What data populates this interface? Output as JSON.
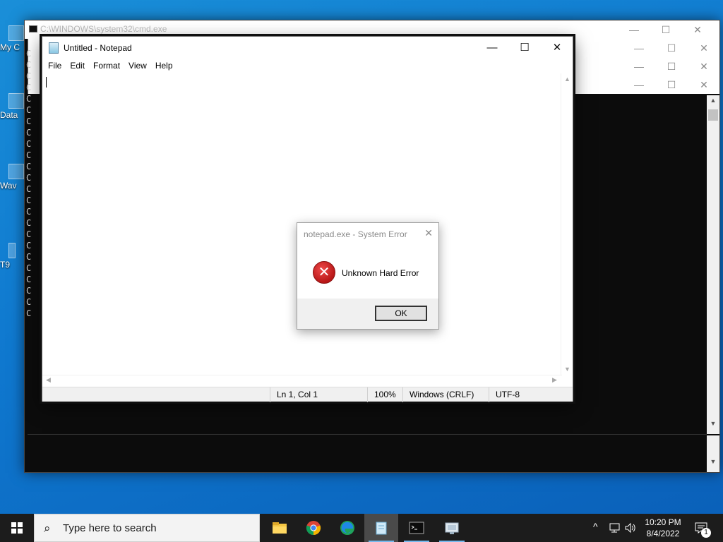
{
  "desktop": {
    "icons": [
      {
        "label": "My C",
        "icon": "computer-icon"
      },
      {
        "label": "Data",
        "icon": "shortcut-icon"
      },
      {
        "label": "Wav",
        "icon": "shortcut-icon"
      },
      {
        "label": "T9",
        "icon": "file-icon"
      }
    ]
  },
  "console": {
    "title": "C:\\WINDOWS\\system32\\cmd.exe",
    "line_prefix": "C",
    "controls": {
      "minimize": "—",
      "maximize": "☐",
      "close": "✕"
    }
  },
  "notepad": {
    "title": "Untitled - Notepad",
    "controls": {
      "minimize": "—",
      "maximize": "☐",
      "close": "✕"
    },
    "menu": [
      "File",
      "Edit",
      "Format",
      "View",
      "Help"
    ],
    "content": "",
    "status": {
      "position": "Ln 1, Col 1",
      "zoom": "100%",
      "line_ending": "Windows (CRLF)",
      "encoding": "UTF-8"
    }
  },
  "dialog": {
    "title": "notepad.exe - System Error",
    "icon": "error-icon",
    "message": "Unknown Hard Error",
    "ok_label": "OK",
    "close_glyph": "✕"
  },
  "taskbar": {
    "search_placeholder": "Type here to search",
    "apps": [
      {
        "name": "file-explorer",
        "icon": "folder-icon"
      },
      {
        "name": "chrome",
        "icon": "chrome-icon"
      },
      {
        "name": "edge",
        "icon": "edge-icon"
      },
      {
        "name": "notepad",
        "icon": "notepad-icon",
        "active": true
      },
      {
        "name": "command-prompt",
        "icon": "terminal-icon"
      },
      {
        "name": "system-error",
        "icon": "error-window-icon"
      }
    ],
    "tray": {
      "chevron": "^",
      "time": "10:20 PM",
      "date": "8/4/2022",
      "notifications": "1"
    }
  },
  "colors": {
    "desktop_blue": "#0f78cf",
    "taskbar": "#1c1c1c",
    "error_red": "#c42b1c"
  }
}
